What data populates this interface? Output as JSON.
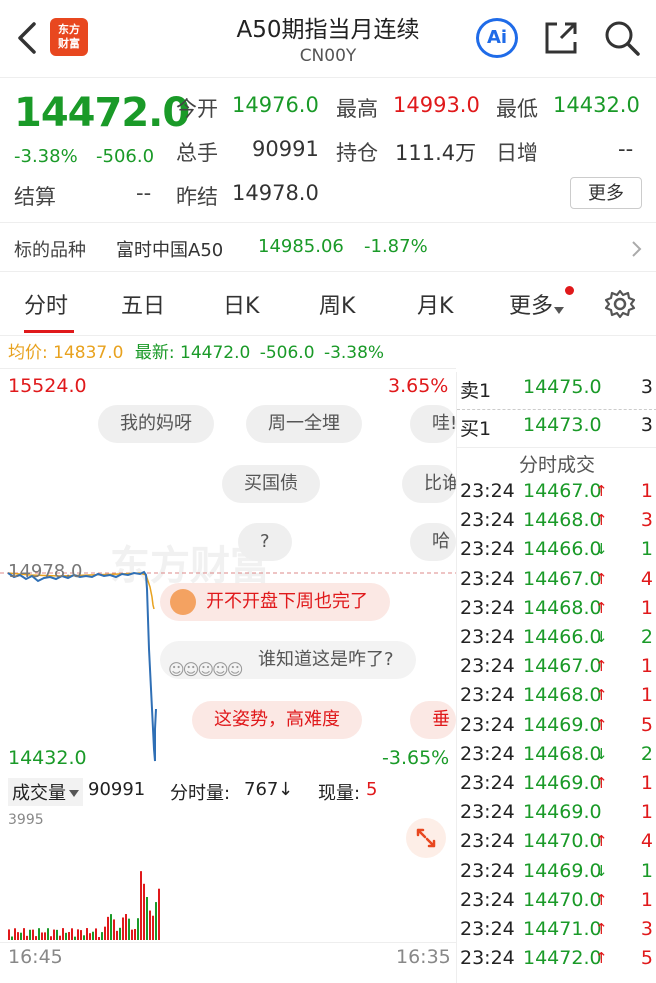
{
  "header": {
    "title": "A50期指当月连续",
    "subtitle": "CN00Y",
    "logo_line1": "东方",
    "logo_line2": "财富",
    "ai_label": "Ai"
  },
  "quote": {
    "price": "14472.0",
    "pct": "-3.38%",
    "change": "-506.0",
    "open_label": "今开",
    "open": "14976.0",
    "high_label": "最高",
    "high": "14993.0",
    "low_label": "最低",
    "low": "14432.0",
    "volume_label": "总手",
    "volume": "90991",
    "oi_label": "持仓",
    "oi": "111.4万",
    "daily_inc_label": "日增",
    "daily_inc": "--",
    "settle_label": "结算",
    "settle": "--",
    "prev_settle_label": "昨结",
    "prev_settle": "14978.0",
    "more_label": "更多"
  },
  "benchmark": {
    "label": "标的品种",
    "name": "富时中国A50",
    "price": "14985.06",
    "pct": "-1.87%"
  },
  "tabs": [
    "分时",
    "五日",
    "日K",
    "周K",
    "月K",
    "更多"
  ],
  "avg_line": {
    "avg_label": "均价:",
    "avg": "14837.0",
    "last_label": "最新:",
    "last": "14472.0",
    "change": "-506.0",
    "pct": "-3.38%"
  },
  "chart": {
    "top_price": "15524.0",
    "top_pct": "3.65%",
    "bottom_price": "14432.0",
    "bottom_pct": "-3.65%",
    "ref_price": "14978.0",
    "watermark": "东方财富",
    "colors": {
      "price_line": "#2f6fb5",
      "avg_line": "#e8a21f",
      "up": "#e0191b",
      "down": "#1a9a28"
    }
  },
  "volume": {
    "dropdown_label": "成交量",
    "total": "90991",
    "tick_label": "分时量:",
    "tick": "767",
    "tick_arrow": "↓",
    "now_label": "现量:",
    "now": "5",
    "scale_max": "3995"
  },
  "time_axis": {
    "start": "16:45",
    "end": "16:35"
  },
  "danmu": [
    "我的妈呀",
    "周一全埋",
    "哇!",
    "买国债",
    "比谁",
    "?",
    "哈",
    "开不开盘下周也完了",
    "谁知道这是咋了?",
    "这姿势，高难度",
    "垂"
  ],
  "order_book": {
    "ask_label": "卖1",
    "ask_price": "14475.0",
    "ask_vol": "3",
    "bid_label": "买1",
    "bid_price": "14473.0",
    "bid_vol": "3",
    "trades_title": "分时成交",
    "trades": [
      {
        "time": "23:24",
        "price": "14467.0",
        "dir": "↑",
        "vol": "1"
      },
      {
        "time": "23:24",
        "price": "14468.0",
        "dir": "↑",
        "vol": "3"
      },
      {
        "time": "23:24",
        "price": "14466.0",
        "dir": "↓",
        "vol": "1"
      },
      {
        "time": "23:24",
        "price": "14467.0",
        "dir": "↑",
        "vol": "4"
      },
      {
        "time": "23:24",
        "price": "14468.0",
        "dir": "↑",
        "vol": "1"
      },
      {
        "time": "23:24",
        "price": "14466.0",
        "dir": "↓",
        "vol": "2"
      },
      {
        "time": "23:24",
        "price": "14467.0",
        "dir": "↑",
        "vol": "1"
      },
      {
        "time": "23:24",
        "price": "14468.0",
        "dir": "↑",
        "vol": "1"
      },
      {
        "time": "23:24",
        "price": "14469.0",
        "dir": "↑",
        "vol": "5"
      },
      {
        "time": "23:24",
        "price": "14468.0",
        "dir": "↓",
        "vol": "2"
      },
      {
        "time": "23:24",
        "price": "14469.0",
        "dir": "↑",
        "vol": "1"
      },
      {
        "time": "23:24",
        "price": "14469.0",
        "dir": "",
        "vol": "1"
      },
      {
        "time": "23:24",
        "price": "14470.0",
        "dir": "↑",
        "vol": "4"
      },
      {
        "time": "23:24",
        "price": "14469.0",
        "dir": "↓",
        "vol": "1"
      },
      {
        "time": "23:24",
        "price": "14470.0",
        "dir": "↑",
        "vol": "1"
      },
      {
        "time": "23:24",
        "price": "14471.0",
        "dir": "↑",
        "vol": "3"
      },
      {
        "time": "23:24",
        "price": "14472.0",
        "dir": "↑",
        "vol": "5"
      }
    ]
  }
}
